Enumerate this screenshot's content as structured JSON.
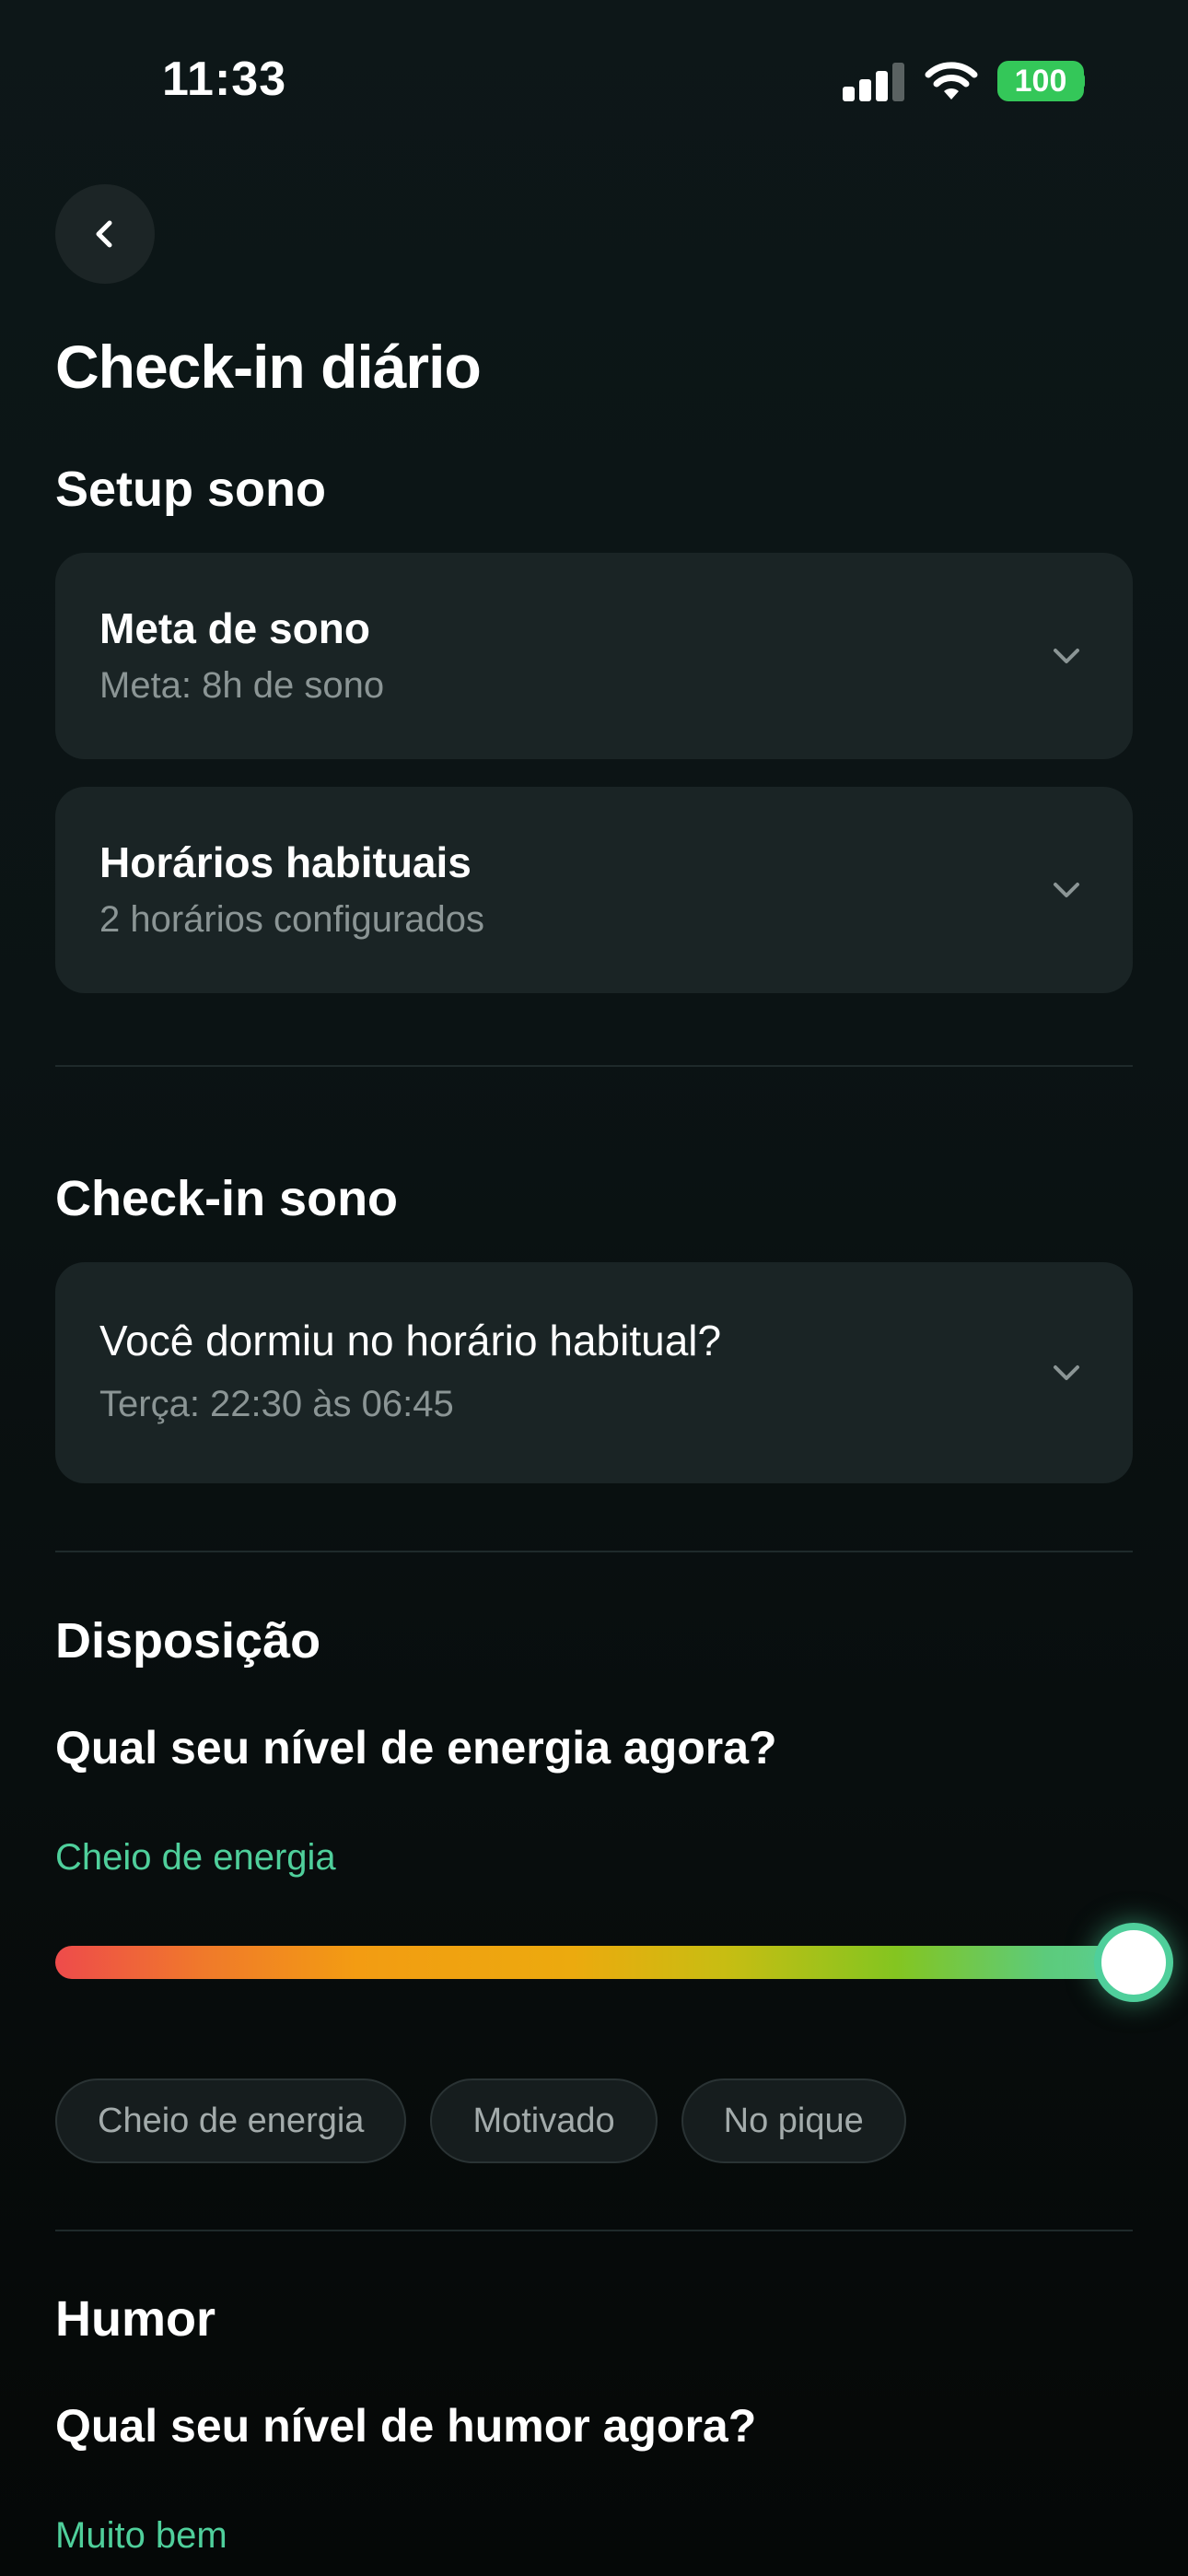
{
  "status_bar": {
    "time": "11:33",
    "battery": "100"
  },
  "page": {
    "title": "Check-in diário"
  },
  "setup_sono": {
    "title": "Setup sono",
    "cards": [
      {
        "title": "Meta de sono",
        "subtitle": "Meta: 8h de sono"
      },
      {
        "title": "Horários habituais",
        "subtitle": "2 horários configurados"
      }
    ]
  },
  "checkin_sono": {
    "title": "Check-in sono",
    "card": {
      "title": "Você dormiu no horário habitual?",
      "subtitle": "Terça: 22:30 às 06:45"
    }
  },
  "disposicao": {
    "title": "Disposição",
    "question": "Qual seu nível de energia agora?",
    "level_label": "Cheio de energia",
    "slider_value_fraction": 1.0,
    "chips": [
      "Cheio de energia",
      "Motivado",
      "No pique"
    ]
  },
  "humor": {
    "title": "Humor",
    "question": "Qual seu nível de humor agora?",
    "level_label": "Muito bem"
  },
  "colors": {
    "accent": "#4fcf9b",
    "card_bg": "#1a2425",
    "battery": "#34c759"
  },
  "icons": {
    "back": "chevron-left-icon",
    "expand": "chevron-down-icon",
    "signal": "cellular-signal-icon",
    "wifi": "wifi-icon",
    "battery": "battery-icon"
  }
}
